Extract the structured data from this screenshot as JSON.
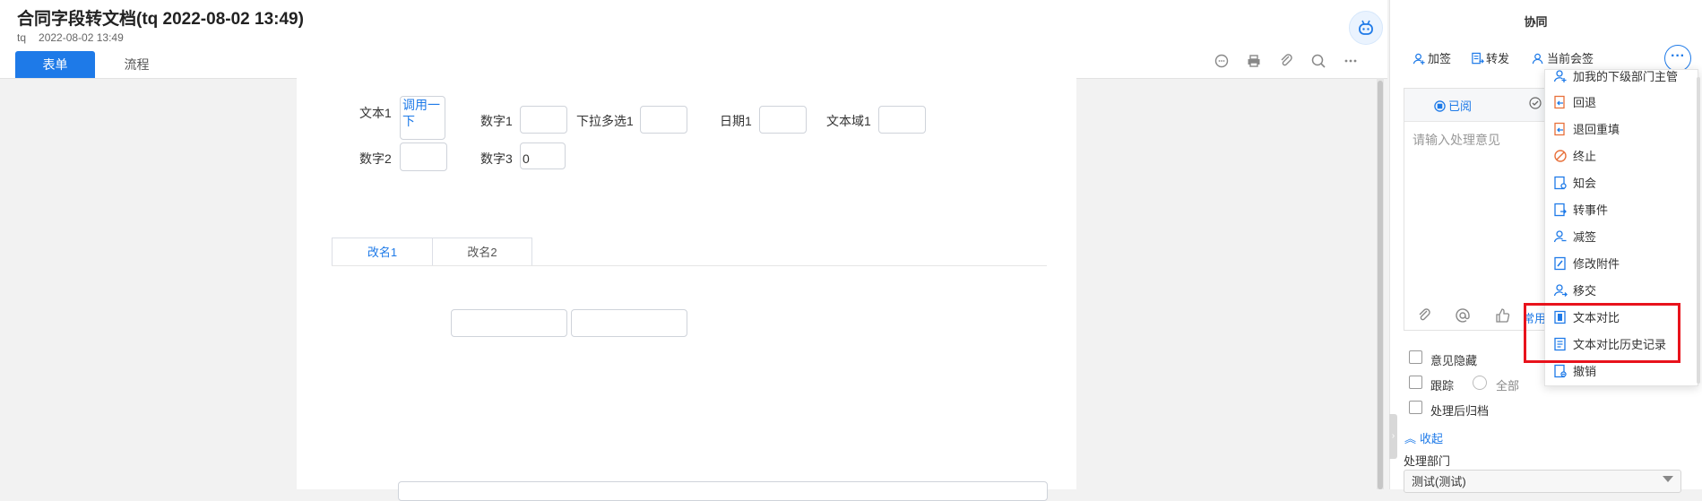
{
  "header": {
    "title": "合同字段转文档(tq 2022-08-02 13:49)",
    "author": "tq",
    "date": "2022-08-02 13:49",
    "tabs": [
      {
        "label": "表单",
        "active": true
      },
      {
        "label": "流程",
        "active": false
      }
    ],
    "toolbar_icons": [
      "comment-icon",
      "print-icon",
      "attachment-icon",
      "search-icon",
      "more-icon"
    ]
  },
  "form": {
    "fields": {
      "text1": {
        "label": "文本1",
        "value": "调用一下"
      },
      "num1": {
        "label": "数字1",
        "value": ""
      },
      "dropdown1": {
        "label": "下拉多选1",
        "value": ""
      },
      "date1": {
        "label": "日期1",
        "value": ""
      },
      "textarea1": {
        "label": "文本域1",
        "value": ""
      },
      "num2": {
        "label": "数字2",
        "value": ""
      },
      "num3": {
        "label": "数字3",
        "value": "0"
      }
    },
    "tabs": [
      {
        "label": "改名1",
        "active": true
      },
      {
        "label": "改名2",
        "active": false
      }
    ]
  },
  "panel": {
    "title": "协同",
    "actions": [
      {
        "label": "加签",
        "icon": "add-sign-icon"
      },
      {
        "label": "转发",
        "icon": "forward-icon"
      },
      {
        "label": "当前会签",
        "icon": "cosign-icon"
      }
    ],
    "more_label": "···",
    "opinion": {
      "read_label": "已阅",
      "check_label": "✓",
      "placeholder": "请输入处理意见",
      "common_label": "常用",
      "tools": [
        "attachment-icon",
        "at-icon",
        "like-icon"
      ]
    },
    "options": {
      "hide_opinion": "意见隐藏",
      "track": "跟踪",
      "track_all": "全部",
      "archive_after": "处理后归档"
    },
    "collapse_label": "收起",
    "dept_label": "处理部门",
    "dept_value": "测试(测试)"
  },
  "menu": {
    "items": [
      {
        "label": "加我的下级部门主管",
        "icon": "user-plus-icon",
        "color": "#1e7ae8"
      },
      {
        "label": "回退",
        "icon": "return-icon",
        "color": "#e8703a"
      },
      {
        "label": "退回重填",
        "icon": "return-refill-icon",
        "color": "#e8703a"
      },
      {
        "label": "终止",
        "icon": "stop-icon",
        "color": "#e8703a"
      },
      {
        "label": "知会",
        "icon": "notify-icon",
        "color": "#1e7ae8"
      },
      {
        "label": "转事件",
        "icon": "to-event-icon",
        "color": "#1e7ae8"
      },
      {
        "label": "减签",
        "icon": "remove-sign-icon",
        "color": "#1e7ae8"
      },
      {
        "label": "修改附件",
        "icon": "edit-attachment-icon",
        "color": "#1e7ae8"
      },
      {
        "label": "移交",
        "icon": "transfer-icon",
        "color": "#1e7ae8"
      },
      {
        "label": "文本对比",
        "icon": "text-compare-icon",
        "color": "#1e7ae8"
      },
      {
        "label": "文本对比历史记录",
        "icon": "compare-history-icon",
        "color": "#1e7ae8"
      },
      {
        "label": "撤销",
        "icon": "revoke-icon",
        "color": "#1e7ae8"
      }
    ],
    "highlight_color": "#e8131c"
  },
  "colors": {
    "accent": "#1e7ae8",
    "warning": "#e8703a"
  }
}
